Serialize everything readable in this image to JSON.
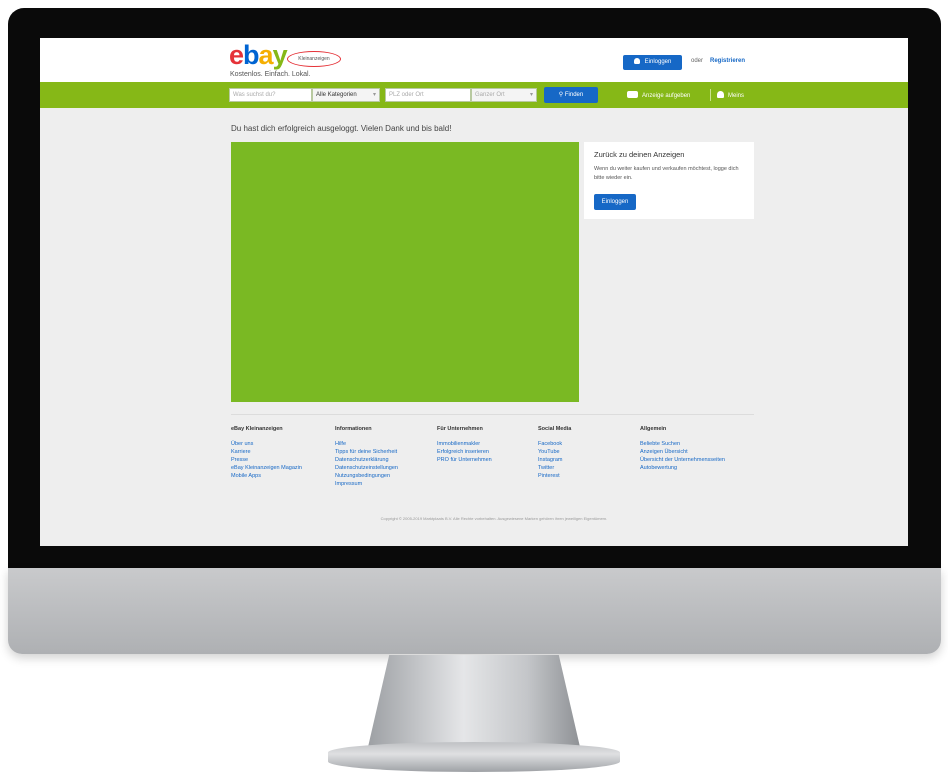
{
  "header": {
    "logo_letters": [
      "e",
      "b",
      "a",
      "y"
    ],
    "logo_badge": "Kleinanzeigen",
    "tagline": "Kostenlos. Einfach. Lokal.",
    "login_label": "Einloggen",
    "or_label": "oder",
    "register_label": "Registrieren"
  },
  "search": {
    "query_placeholder": "Was suchst du?",
    "category_value": "Alle Kategorien",
    "location_placeholder": "PLZ oder Ort",
    "radius_value": "Ganzer Ort",
    "find_label": "Finden",
    "post_ad_label": "Anzeige aufgeben",
    "my_label": "Meins"
  },
  "main": {
    "logout_message": "Du hast dich erfolgreich ausgeloggt. Vielen Dank und bis bald!"
  },
  "side_card": {
    "title": "Zurück zu deinen Anzeigen",
    "text": "Wenn du weiter kaufen und verkaufen möchtest, logge dich bitte wieder ein.",
    "button_label": "Einloggen"
  },
  "footer": {
    "columns": [
      {
        "heading": "eBay Kleinanzeigen",
        "links": [
          "Über uns",
          "Karriere",
          "Presse",
          "eBay Kleinanzeigen Magazin",
          "Mobile Apps"
        ]
      },
      {
        "heading": "Informationen",
        "links": [
          "Hilfe",
          "Tipps für deine Sicherheit",
          "Datenschutzerklärung",
          "Datenschutzeinstellungen",
          "Nutzungsbedingungen",
          "Impressum"
        ]
      },
      {
        "heading": "Für Unternehmen",
        "links": [
          "Immobilienmakler",
          "Erfolgreich inserieren",
          "PRO für Unternehmen"
        ]
      },
      {
        "heading": "Social Media",
        "links": [
          "Facebook",
          "YouTube",
          "Instagram",
          "Twitter",
          "Pinterest"
        ]
      },
      {
        "heading": "Allgemein",
        "links": [
          "Beliebte Suchen",
          "Anzeigen Übersicht",
          "Übersicht der Unternehmensseiten",
          "Autobewertung"
        ]
      }
    ],
    "copyright": "Copyright © 2005-2019 Marktplaats B.V. Alle Rechte vorbehalten. Ausgewiesene Marken gehören ihren jeweiligen Eigentümern."
  },
  "colors": {
    "brand_green": "#86b817",
    "link_blue": "#1668c6",
    "ad_green": "#7ab923"
  }
}
